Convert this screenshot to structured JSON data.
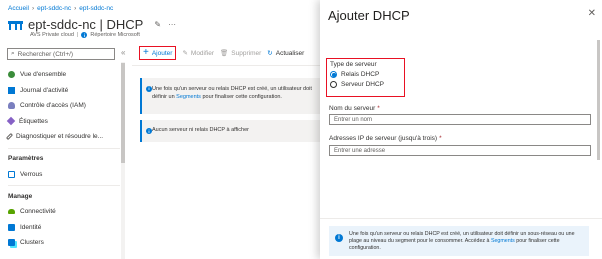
{
  "breadcrumb": [
    "Accueil",
    "ept-sddc-nc",
    "ept-sddc-nc"
  ],
  "page": {
    "title": "ept-sddc-nc | DHCP",
    "subtitle": "AVS Private cloud",
    "doc_link": "Répertoire Microsoft"
  },
  "search": {
    "placeholder": "Rechercher (Ctrl+/)"
  },
  "nav": {
    "items_top": [
      "Vue d'ensemble",
      "Journal d'activité",
      "Contrôle d'accès (IAM)",
      "Étiquettes",
      "Diagnostiquer et résoudre le..."
    ],
    "section_params": "Paramètres",
    "items_params": [
      "Verrous"
    ],
    "section_manage": "Manage",
    "items_manage": [
      "Connectivité",
      "Identité",
      "Clusters"
    ]
  },
  "toolbar": {
    "add": "Ajouter",
    "edit": "Modifier",
    "delete": "Supprimer",
    "refresh": "Actualiser"
  },
  "info_banner": {
    "text_before": "Une fois qu'un serveur ou relais DHCP est créé, un utilisateur doit définir un",
    "link": "Segments",
    "text_after": "pour finaliser cette configuration."
  },
  "empty_banner": "Aucun serveur ni relais DHCP à afficher",
  "panel": {
    "title": "Ajouter DHCP",
    "server_type_label": "Type de serveur",
    "options": [
      "Relais DHCP",
      "Serveur DHCP"
    ],
    "selected": "Relais DHCP",
    "name_label": "Nom du serveur",
    "name_placeholder": "Entrer un nom",
    "ip_label": "Adresses IP de serveur (jusqu'à trois)",
    "ip_placeholder": "Entrer une adresse",
    "info_before": "Une fois qu'un serveur ou relais DHCP est créé, un utilisateur doit définir un sous-réseau ou une plage au niveau du segment pour le consommer. Accédez à",
    "info_link": "Segments",
    "info_after": "pour finaliser cette configuration."
  },
  "colors": {
    "accent": "#0078d4",
    "highlight": "#e81123"
  }
}
